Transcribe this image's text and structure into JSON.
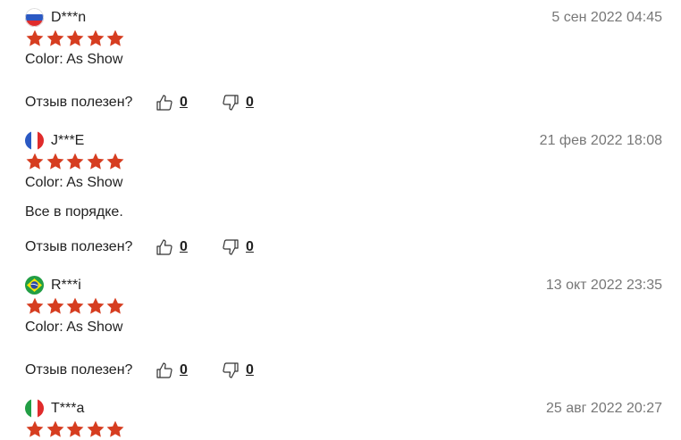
{
  "reviews": [
    {
      "author": "D***n",
      "date": "5 сен 2022 04:45",
      "flag": "flag-russia-icon",
      "rating": 5,
      "color": "Color: As Show",
      "text": "",
      "helpful_label": "Отзыв полезен?",
      "likes": "0",
      "dislikes": "0"
    },
    {
      "author": "J***E",
      "date": "21 фев 2022 18:08",
      "flag": "flag-france-icon",
      "rating": 5,
      "color": "Color: As Show",
      "text": "Все в порядке.",
      "helpful_label": "Отзыв полезен?",
      "likes": "0",
      "dislikes": "0"
    },
    {
      "author": "R***i",
      "date": "13 окт 2022 23:35",
      "flag": "flag-brazil-icon",
      "rating": 5,
      "color": "Color: As Show",
      "text": "",
      "helpful_label": "Отзыв полезен?",
      "likes": "0",
      "dislikes": "0"
    },
    {
      "author": "T***a",
      "date": "25 авг 2022 20:27",
      "flag": "flag-italy-icon",
      "rating": 5,
      "color": "",
      "text": "",
      "helpful_label": "",
      "likes": "",
      "dislikes": ""
    }
  ],
  "colors": {
    "star": "#d63d20",
    "text": "#222222",
    "muted": "#777777"
  }
}
